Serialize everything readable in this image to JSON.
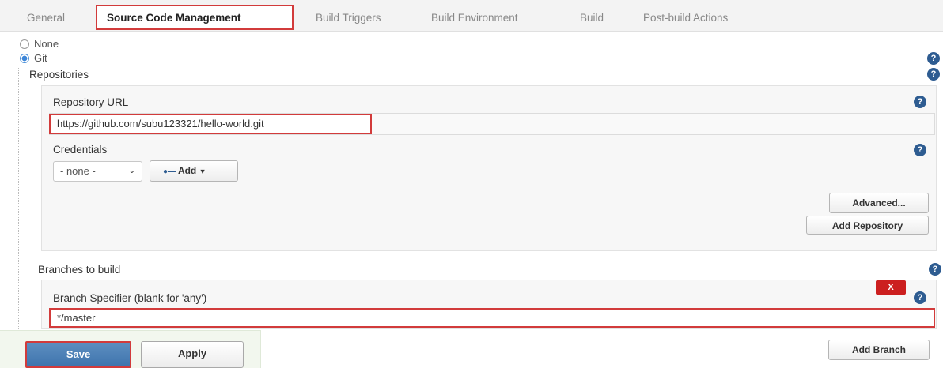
{
  "tabs": [
    {
      "label": "General"
    },
    {
      "label": "Source Code Management"
    },
    {
      "label": "Build Triggers"
    },
    {
      "label": "Build Environment"
    },
    {
      "label": "Build"
    },
    {
      "label": "Post-build Actions"
    }
  ],
  "scm": {
    "options": [
      {
        "label": "None",
        "checked": false
      },
      {
        "label": "Git",
        "checked": true
      }
    ],
    "repositories_title": "Repositories",
    "repo_url_label": "Repository URL",
    "repo_url_value": "https://github.com/subu123321/hello-world.git",
    "credentials_label": "Credentials",
    "credentials_selected": "- none -",
    "add_label": "Add",
    "advanced_label": "Advanced...",
    "add_repository_label": "Add Repository"
  },
  "branches": {
    "title": "Branches to build",
    "specifier_label": "Branch Specifier (blank for 'any')",
    "specifier_value": "*/master",
    "delete_label": "X",
    "add_branch_label": "Add Branch"
  },
  "footer": {
    "save_label": "Save",
    "apply_label": "Apply"
  },
  "help_icon": "?",
  "colors": {
    "highlight": "#d23b3b",
    "help_blue": "#2e5c91",
    "save_blue": "#4a80b8",
    "delete_red": "#cc1f1f"
  }
}
